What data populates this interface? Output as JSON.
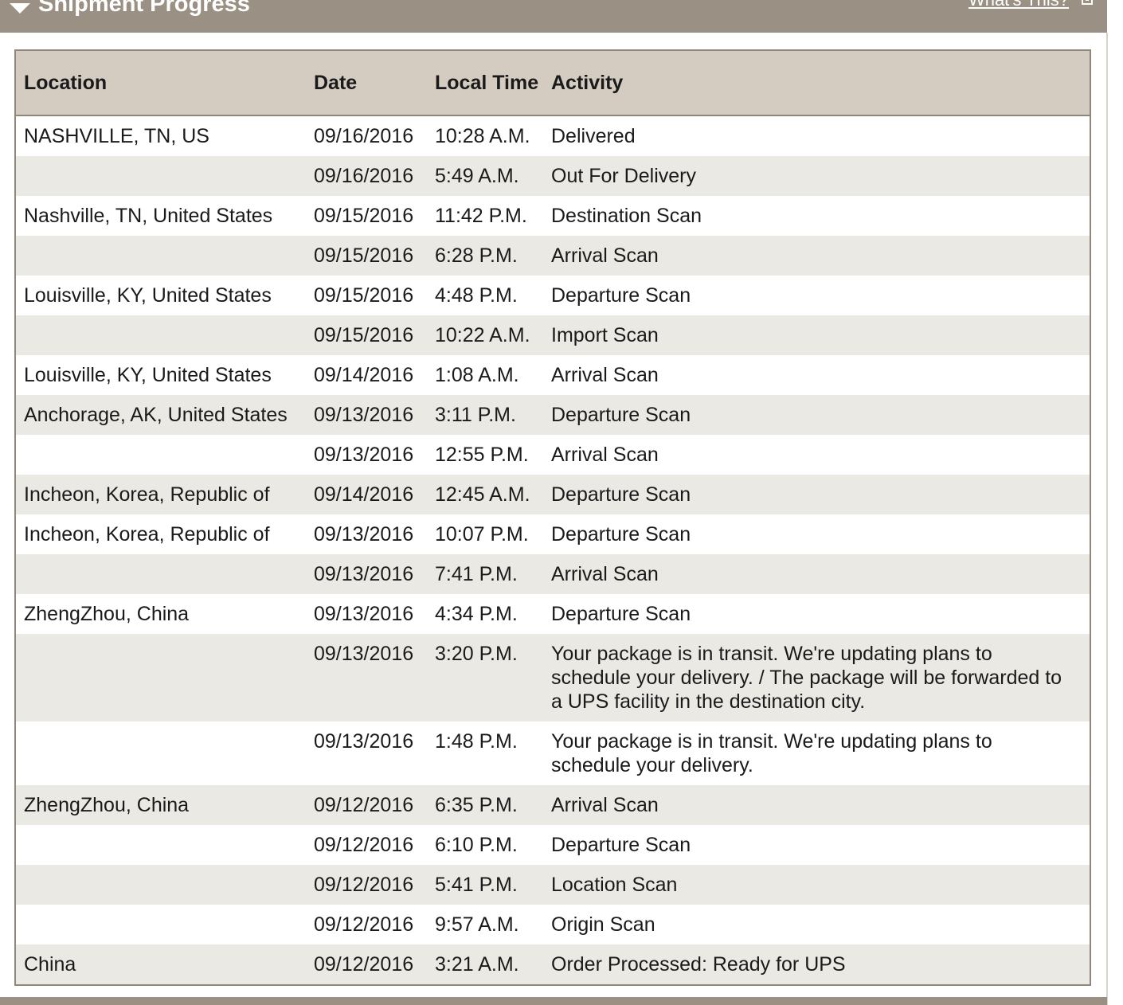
{
  "header": {
    "title": "Shipment Progress",
    "whats_this": "What's This?"
  },
  "table": {
    "columns": {
      "location": "Location",
      "date": "Date",
      "time": "Local Time",
      "activity": "Activity"
    },
    "rows": [
      {
        "location": "NASHVILLE, TN, US",
        "date": "09/16/2016",
        "time": "10:28 A.M.",
        "activity": "Delivered"
      },
      {
        "location": "",
        "date": "09/16/2016",
        "time": "5:49 A.M.",
        "activity": "Out For Delivery"
      },
      {
        "location": "Nashville, TN, United States",
        "date": "09/15/2016",
        "time": "11:42 P.M.",
        "activity": "Destination Scan"
      },
      {
        "location": "",
        "date": "09/15/2016",
        "time": "6:28 P.M.",
        "activity": "Arrival Scan"
      },
      {
        "location": "Louisville, KY, United States",
        "date": "09/15/2016",
        "time": "4:48 P.M.",
        "activity": "Departure Scan"
      },
      {
        "location": "",
        "date": "09/15/2016",
        "time": "10:22 A.M.",
        "activity": "Import Scan"
      },
      {
        "location": "Louisville, KY, United States",
        "date": "09/14/2016",
        "time": "1:08 A.M.",
        "activity": "Arrival Scan"
      },
      {
        "location": "Anchorage, AK, United States",
        "date": "09/13/2016",
        "time": "3:11 P.M.",
        "activity": "Departure Scan"
      },
      {
        "location": "",
        "date": "09/13/2016",
        "time": "12:55 P.M.",
        "activity": "Arrival Scan"
      },
      {
        "location": "Incheon, Korea, Republic of",
        "date": "09/14/2016",
        "time": "12:45 A.M.",
        "activity": "Departure Scan"
      },
      {
        "location": "Incheon, Korea, Republic of",
        "date": "09/13/2016",
        "time": "10:07 P.M.",
        "activity": "Departure Scan"
      },
      {
        "location": "",
        "date": "09/13/2016",
        "time": "7:41 P.M.",
        "activity": "Arrival Scan"
      },
      {
        "location": "ZhengZhou, China",
        "date": "09/13/2016",
        "time": "4:34 P.M.",
        "activity": "Departure Scan"
      },
      {
        "location": "",
        "date": "09/13/2016",
        "time": "3:20 P.M.",
        "activity": "Your package is in transit. We're updating plans to schedule your delivery. / The package will be forwarded to a UPS facility in the destination city."
      },
      {
        "location": "",
        "date": "09/13/2016",
        "time": "1:48 P.M.",
        "activity": "Your package is in transit. We're updating plans to schedule your delivery."
      },
      {
        "location": "ZhengZhou, China",
        "date": "09/12/2016",
        "time": "6:35 P.M.",
        "activity": "Arrival Scan"
      },
      {
        "location": "",
        "date": "09/12/2016",
        "time": "6:10 P.M.",
        "activity": "Departure Scan"
      },
      {
        "location": "",
        "date": "09/12/2016",
        "time": "5:41 P.M.",
        "activity": "Location Scan"
      },
      {
        "location": "",
        "date": "09/12/2016",
        "time": "9:57 A.M.",
        "activity": "Origin Scan"
      },
      {
        "location": "China",
        "date": "09/12/2016",
        "time": "3:21 A.M.",
        "activity": "Order Processed: Ready for UPS"
      }
    ]
  }
}
